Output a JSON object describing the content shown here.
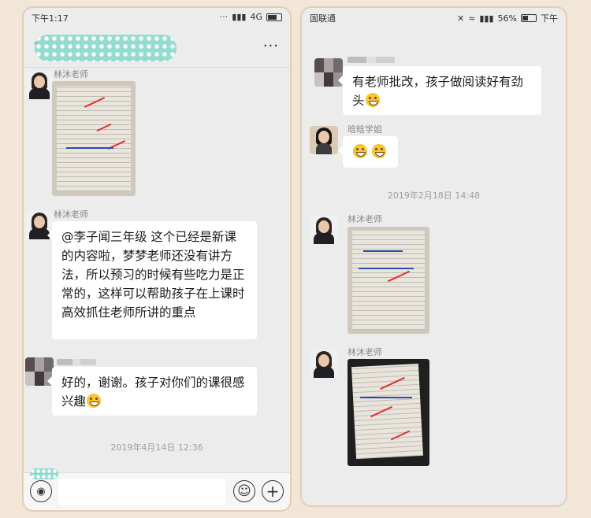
{
  "left": {
    "status": {
      "time": "下午1:17",
      "network": "4G"
    },
    "header": {
      "more_label": "···"
    },
    "messages": [
      {
        "sender": "林沐老师"
      },
      {
        "sender": "林沐老师",
        "text": "@李子闻三年级 这个已经是新课的内容啦，梦梦老师还没有讲方法，所以预习的时候有些吃力是正常的，这样可以帮助孩子在上课时高效抓住老师所讲的重点"
      },
      {
        "text": "好的，谢谢。孩子对你们的课很感兴趣"
      }
    ],
    "timestamp": "2019年4月14日 12:36",
    "input": {
      "placeholder": ""
    }
  },
  "right": {
    "status": {
      "carrier": "国联通",
      "battery": "56%",
      "time": "下午"
    },
    "messages": [
      {
        "text": "有老师批改，孩子做阅读好有劲头"
      },
      {
        "sender": "晗晗学姐"
      },
      {
        "sender": "林沐老师"
      },
      {
        "sender": "林沐老师"
      }
    ],
    "timestamp": "2019年2月18日 14:48"
  },
  "icons": {
    "back": "back-icon",
    "more": "more-icon",
    "voice": "voice-icon",
    "emoji": "emoji-icon",
    "plus": "plus-icon"
  },
  "colors": {
    "page_bg": "#f1e6d8",
    "chat_bg": "#ececec",
    "bubble": "#ffffff",
    "frame": "#e3cfb2"
  }
}
